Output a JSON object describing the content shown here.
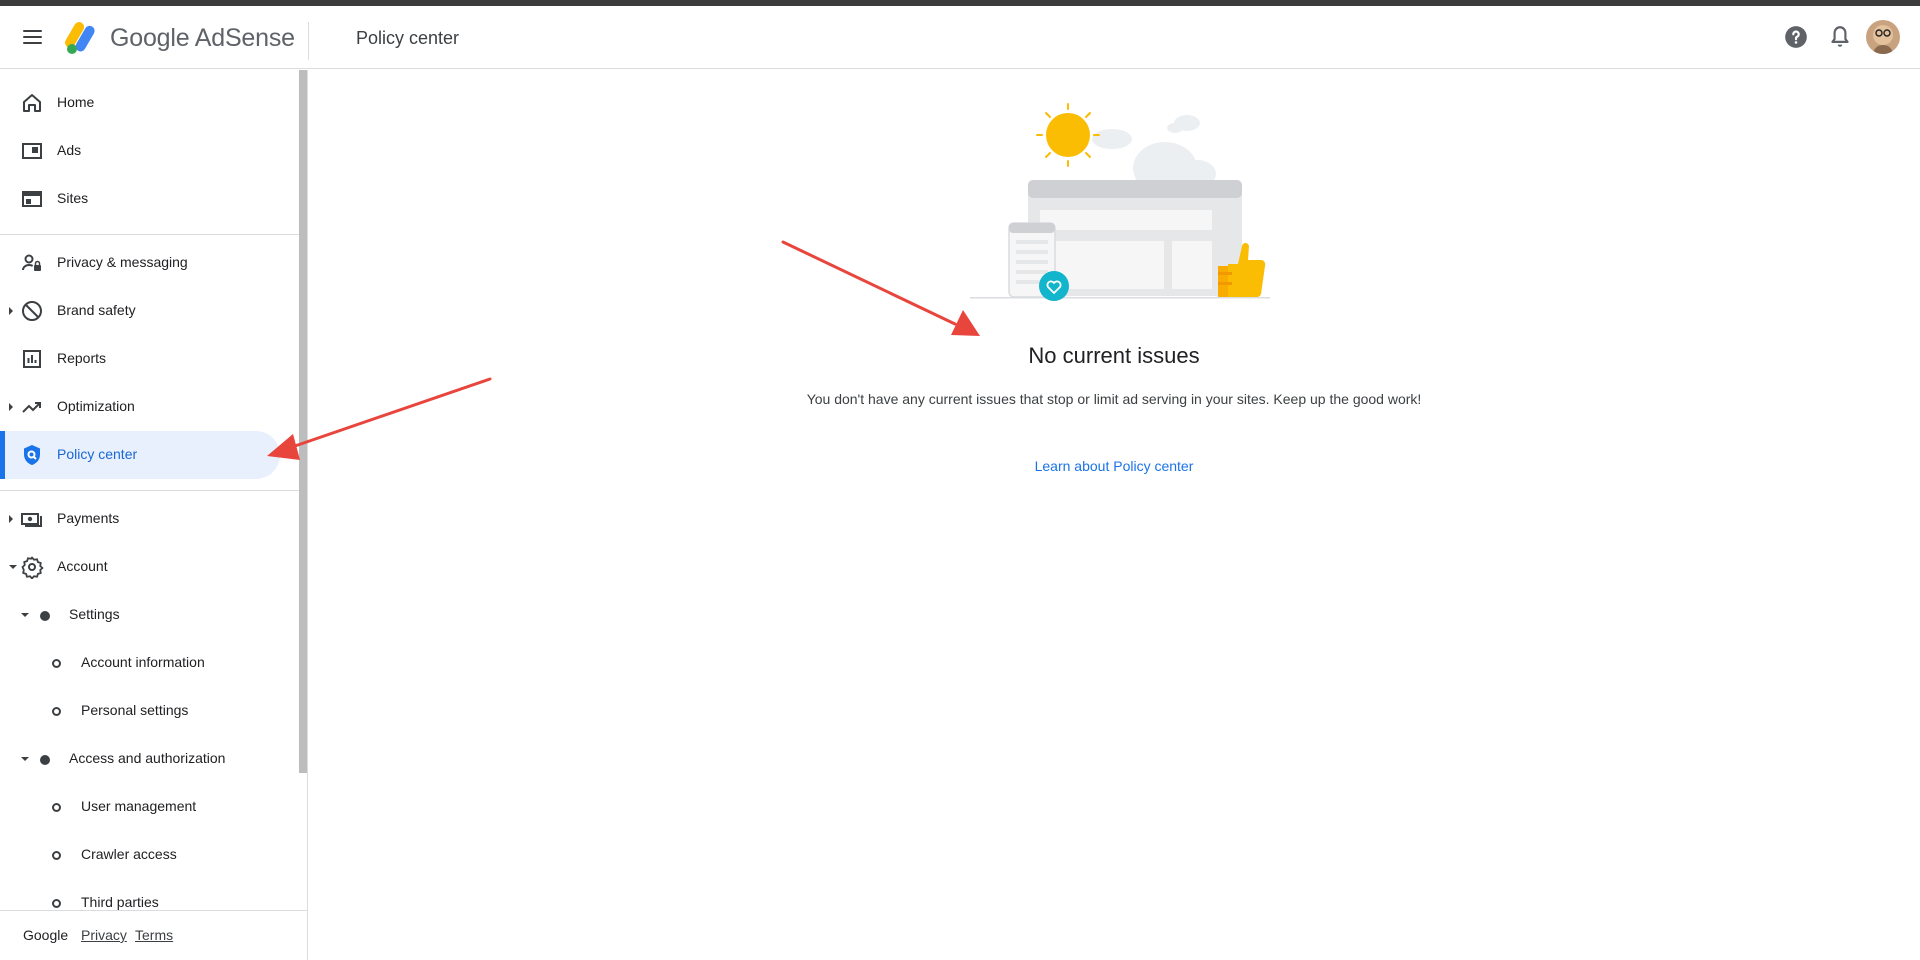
{
  "header": {
    "brand": "Google AdSense",
    "title": "Policy center"
  },
  "sidebar": {
    "items": [
      {
        "label": "Home"
      },
      {
        "label": "Ads"
      },
      {
        "label": "Sites"
      },
      {
        "label": "Privacy & messaging"
      },
      {
        "label": "Brand safety"
      },
      {
        "label": "Reports"
      },
      {
        "label": "Optimization"
      },
      {
        "label": "Policy center"
      },
      {
        "label": "Payments"
      },
      {
        "label": "Account"
      }
    ],
    "account_sub": {
      "settings": "Settings",
      "account_information": "Account information",
      "personal_settings": "Personal settings",
      "access": "Access and authorization",
      "user_management": "User management",
      "crawler_access": "Crawler access",
      "third_parties": "Third parties"
    }
  },
  "footer": {
    "google": "Google",
    "privacy": "Privacy",
    "terms": "Terms"
  },
  "main": {
    "heading": "No current issues",
    "description": "You don't have any current issues that stop or limit ad serving in your sites. Keep up the good work!",
    "link": "Learn about Policy center"
  },
  "colors": {
    "accent": "#1a73e8",
    "active_bg": "#e8f0fe",
    "annotation_arrow": "#e8453c"
  },
  "icons": [
    "menu-icon",
    "adsense-logo",
    "help-icon",
    "notifications-icon",
    "home-icon",
    "ads-icon",
    "sites-icon",
    "privacy-icon",
    "brand-safety-icon",
    "reports-icon",
    "optimization-icon",
    "policy-shield-icon",
    "payments-icon",
    "account-gear-icon"
  ]
}
